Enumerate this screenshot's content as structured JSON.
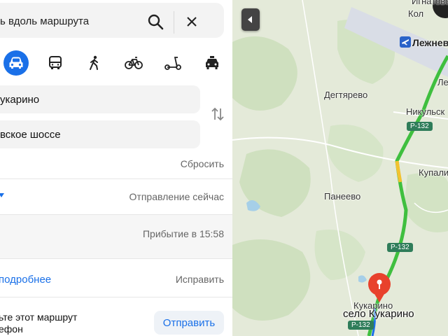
{
  "search": {
    "text": "ь вдоль маршрута"
  },
  "transport_modes": [
    {
      "name": "car-icon",
      "active": true
    },
    {
      "name": "bus-icon",
      "active": false
    },
    {
      "name": "walk-icon",
      "active": false
    },
    {
      "name": "bicycle-icon",
      "active": false
    },
    {
      "name": "scooter-icon",
      "active": false
    },
    {
      "name": "taxi-icon",
      "active": false
    }
  ],
  "route": {
    "from": "укарино",
    "to": "вское шоссе",
    "reset_label": "Сбросить",
    "departure_label": "Отправление сейчас",
    "arrival_label": "Прибытие в 15:58",
    "details_label": "подробнее",
    "fix_label": "Исправить"
  },
  "send": {
    "text_line1": "ьте этот маршрут",
    "text_line2": "ефон",
    "button_label": "Отправить"
  },
  "map": {
    "places": [
      {
        "label": "Игнатово"
      },
      {
        "label": "Кол"
      },
      {
        "label": "Дегтярево"
      },
      {
        "label": "Никульск"
      },
      {
        "label": "Лег"
      },
      {
        "label": "Купали"
      },
      {
        "label": "Панеево"
      },
      {
        "label": "Кукарино"
      }
    ],
    "airport_label": "Лежнев",
    "destination_label": "село Кукарино",
    "road_badges": [
      "Р-132",
      "Р-132",
      "Р-132"
    ],
    "colors": {
      "route": "#3fbf3f",
      "pin": "#e8412c",
      "accent": "#1a70e8"
    }
  }
}
